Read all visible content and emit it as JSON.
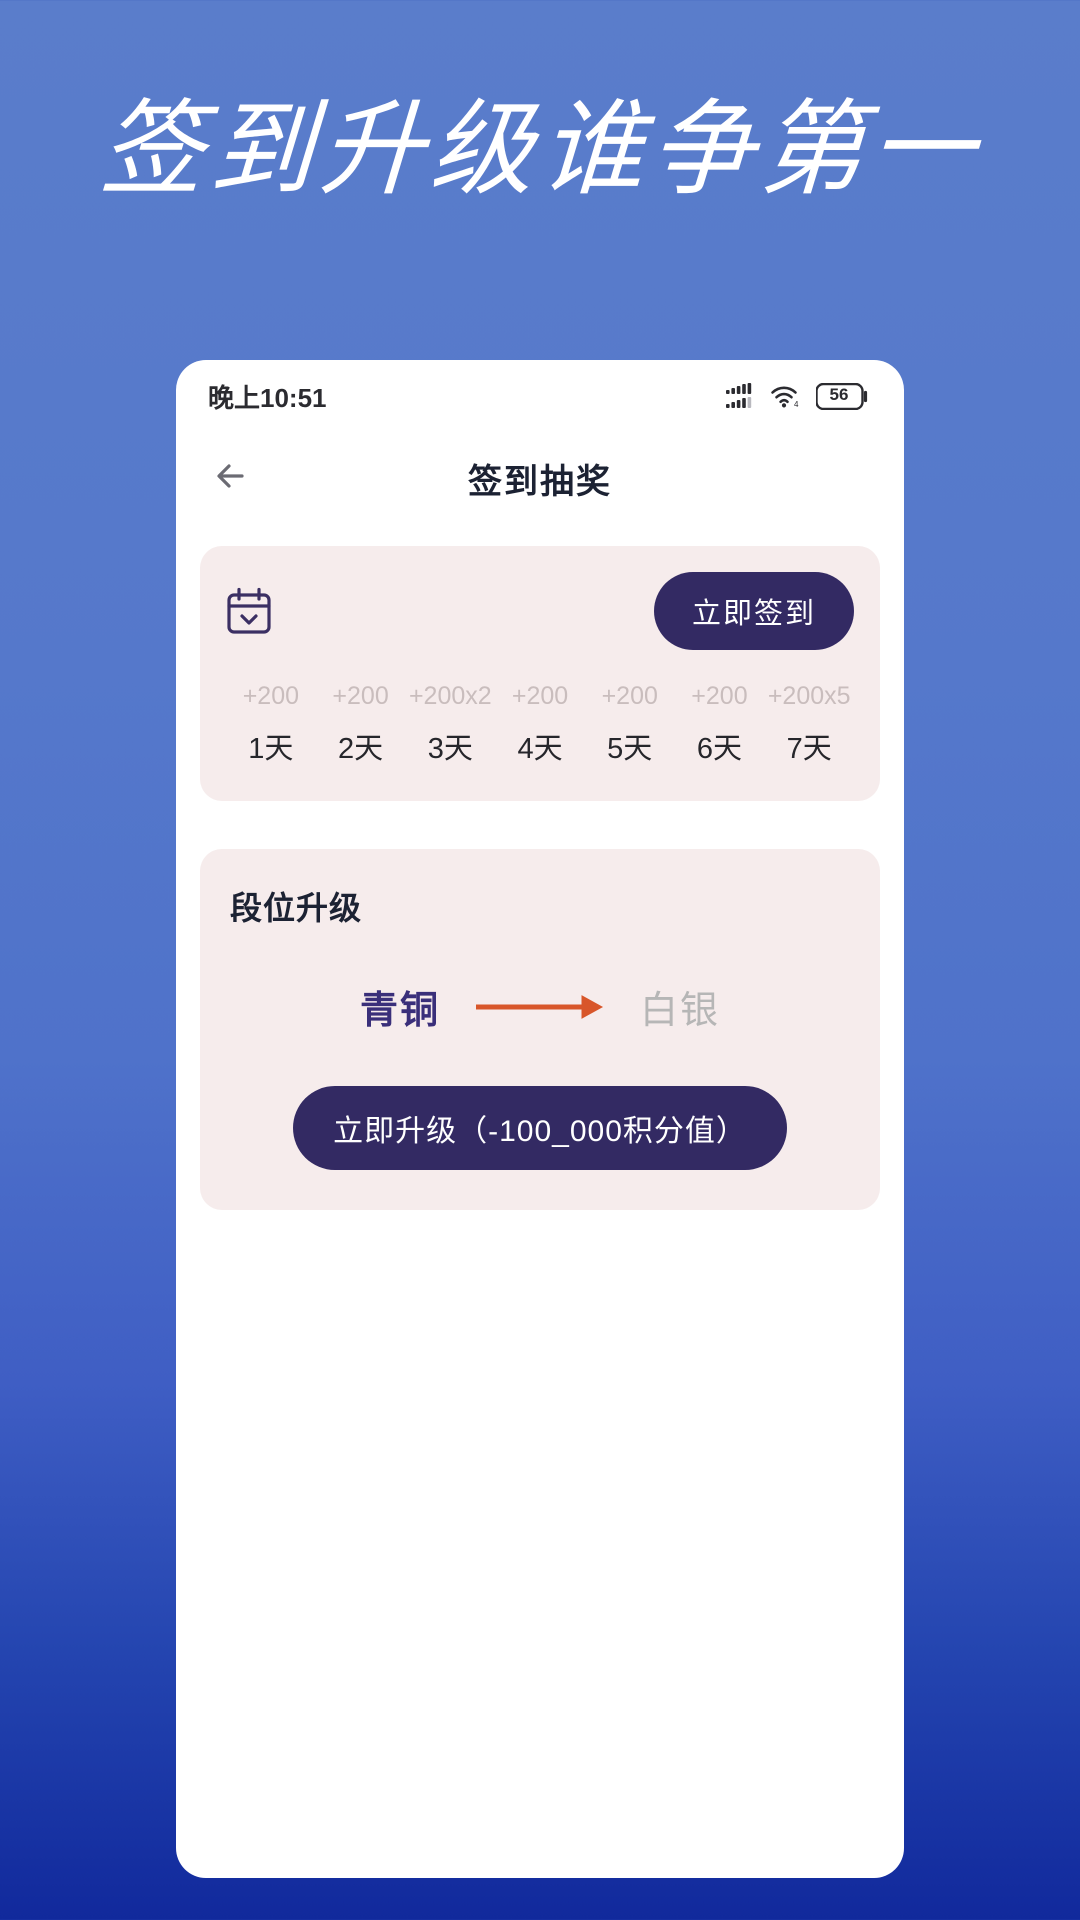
{
  "hero": {
    "title": "签到升级谁争第一"
  },
  "statusbar": {
    "time": "晚上10:51",
    "battery_level": "56",
    "icons": [
      "signal-icon",
      "wifi-icon",
      "battery-icon"
    ]
  },
  "appbar": {
    "back_icon": "arrow-left-icon",
    "title": "签到抽奖"
  },
  "checkin": {
    "calendar_icon": "calendar-check-icon",
    "button_label": "立即签到",
    "days": [
      {
        "reward": "+200",
        "label": "1天"
      },
      {
        "reward": "+200",
        "label": "2天"
      },
      {
        "reward": "+200x2",
        "label": "3天"
      },
      {
        "reward": "+200",
        "label": "4天"
      },
      {
        "reward": "+200",
        "label": "5天"
      },
      {
        "reward": "+200",
        "label": "6天"
      },
      {
        "reward": "+200x5",
        "label": "7天"
      }
    ]
  },
  "rank": {
    "title": "段位升级",
    "current_tier": "青铜",
    "next_tier": "白银",
    "arrow_icon": "arrow-right-icon",
    "upgrade_button_label": "立即升级（-100_000积分值）"
  },
  "colors": {
    "background_top": "#5a7dcb",
    "background_bottom": "#11299c",
    "card_bg": "#f6ecec",
    "primary_button": "#332a63",
    "tier_current": "#3a2f7a",
    "tier_next": "#b6b6b6",
    "arrow": "#d8562a",
    "reward_text": "#c9bdbd"
  }
}
